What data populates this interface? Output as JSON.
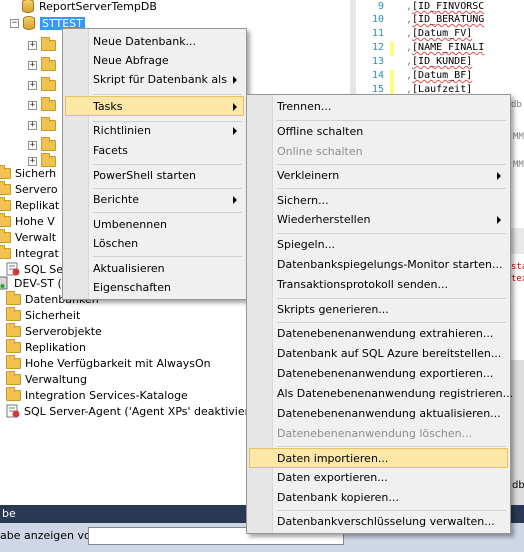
{
  "tree": {
    "items": [
      {
        "label": "ReportServerTempDB"
      },
      {
        "label": "STTEST"
      },
      {
        "label": "Sicherh"
      },
      {
        "label": "Servero"
      },
      {
        "label": "Replikat"
      },
      {
        "label": "Hohe V"
      },
      {
        "label": "Verwalt"
      },
      {
        "label": "Integrat"
      },
      {
        "label": "SQL Ser"
      },
      {
        "label": "DEV-ST (SQ"
      },
      {
        "label": "Datenbanken"
      },
      {
        "label": "Sicherheit"
      },
      {
        "label": "Serverobjekte"
      },
      {
        "label": "Replikation"
      },
      {
        "label": "Hohe Verfügbarkeit mit AlwaysOn"
      },
      {
        "label": "Verwaltung"
      },
      {
        "label": "Integration Services-Kataloge"
      },
      {
        "label": "SQL Server-Agent ('Agent XPs' deaktiviert)"
      }
    ]
  },
  "editor": {
    "lines": [
      {
        "num": "9",
        "code": "[ID_FINVORSC"
      },
      {
        "num": "10",
        "code": "[ID_BERATUNG"
      },
      {
        "num": "11",
        "code": "[Datum_FV]"
      },
      {
        "num": "12",
        "code": "[NAME_FINALI"
      },
      {
        "num": "13",
        "code": "[ID_KUNDE]"
      },
      {
        "num": "14",
        "code": "[Datum_BF]"
      },
      {
        "num": "15",
        "code": "[Laufzeit]"
      }
    ],
    "fragments": {
      "db": "db",
      "mm1": "MM",
      "mm2": "MM",
      "sta": "sta",
      "tex": "tex",
      "dbg": "dbg"
    }
  },
  "context_menu": {
    "items": [
      {
        "label": "Neue Datenbank..."
      },
      {
        "label": "Neue Abfrage"
      },
      {
        "label": "Skript für Datenbank als"
      },
      {
        "label": "Tasks"
      },
      {
        "label": "Richtlinien"
      },
      {
        "label": "Facets"
      },
      {
        "label": "PowerShell starten"
      },
      {
        "label": "Berichte"
      },
      {
        "label": "Umbenennen"
      },
      {
        "label": "Löschen"
      },
      {
        "label": "Aktualisieren"
      },
      {
        "label": "Eigenschaften"
      }
    ]
  },
  "tasks_menu": {
    "items": [
      {
        "label": "Trennen..."
      },
      {
        "label": "Offline schalten"
      },
      {
        "label": "Online schalten"
      },
      {
        "label": "Verkleinern"
      },
      {
        "label": "Sichern..."
      },
      {
        "label": "Wiederherstellen"
      },
      {
        "label": "Spiegeln..."
      },
      {
        "label": "Datenbankspiegelungs-Monitor starten..."
      },
      {
        "label": "Transaktionsprotokoll senden..."
      },
      {
        "label": "Skripts generieren..."
      },
      {
        "label": "Datenebenenanwendung extrahieren..."
      },
      {
        "label": "Datenbank auf SQL Azure bereitstellen..."
      },
      {
        "label": "Datenebenenanwendung exportieren..."
      },
      {
        "label": "Als Datenebenenanwendung registrieren..."
      },
      {
        "label": "Datenebenenanwendung aktualisieren..."
      },
      {
        "label": "Datenebenenanwendung löschen..."
      },
      {
        "label": "Daten importieren..."
      },
      {
        "label": "Daten exportieren..."
      },
      {
        "label": "Datenbank kopieren..."
      },
      {
        "label": "Datenbankverschlüsselung verwalten..."
      }
    ]
  },
  "bottom": {
    "title": "be",
    "filter_label": "abe anzeigen von:",
    "filter_value": ""
  },
  "colors": {
    "selection": "#3399ff",
    "menu_highlight": "#fde7a7",
    "panel_title": "#293955",
    "folder": "#f0c34e"
  }
}
